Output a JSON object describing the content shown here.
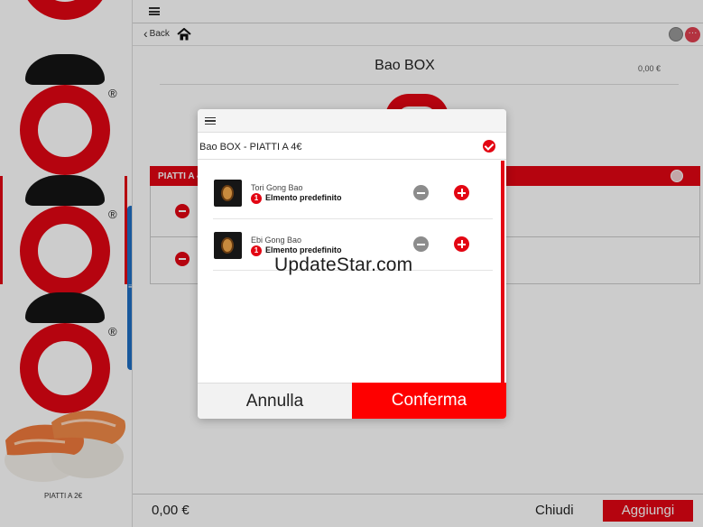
{
  "left_menu": {
    "caption": "PIATTI A 2€",
    "logo_mark": "®"
  },
  "navbar": {
    "back_label": "Back"
  },
  "product": {
    "title": "Bao BOX",
    "price": "0,00 €"
  },
  "section": {
    "label": "PIATTI A 4"
  },
  "footer": {
    "total": "0,00 €",
    "close_label": "Chiudi",
    "add_label": "Aggiungi"
  },
  "modal": {
    "title": "Bao BOX - PIATTI A 4€",
    "items": [
      {
        "name": "Tori Gong Bao",
        "quantity": "1",
        "note": "Elmento predefinito"
      },
      {
        "name": "Ebi Gong Bao",
        "quantity": "1",
        "note": "Elmento predefinito"
      }
    ],
    "cancel_label": "Annulla",
    "confirm_label": "Conferma"
  },
  "watermark": "UpdateStar.com",
  "colors": {
    "brand_red": "#e30613",
    "confirm_red": "#fe0000",
    "scrollbar_blue": "#1f6fc4"
  },
  "icons": [
    "menu-icon",
    "back-chevron-icon",
    "home-icon",
    "user-icon",
    "more-icon",
    "check-icon",
    "minus-icon",
    "plus-icon"
  ]
}
